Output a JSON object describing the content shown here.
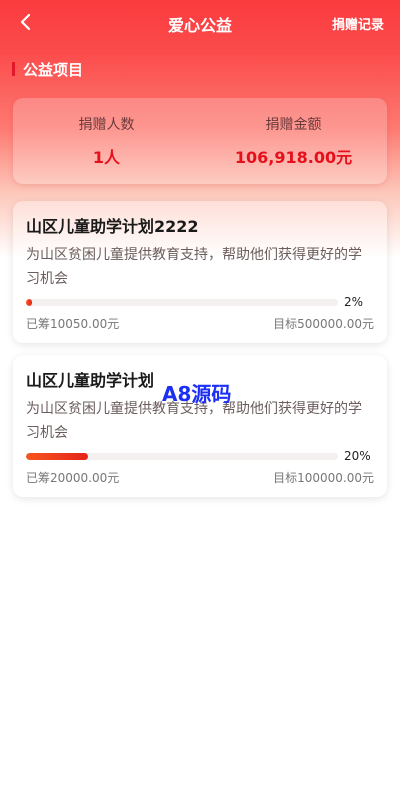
{
  "header": {
    "title": "爱心公益",
    "records_link": "捐赠记录"
  },
  "section": {
    "title": "公益项目"
  },
  "stats": {
    "donors_label": "捐赠人数",
    "donors_value": "1人",
    "amount_label": "捐赠金额",
    "amount_value": "106,918.00元"
  },
  "projects": [
    {
      "title": "山区儿童助学计划2222",
      "desc": "为山区贫困儿童提供教育支持，帮助他们获得更好的学习机会",
      "progress_pct": 2,
      "progress_text": "2%",
      "raised": "已筹10050.00元",
      "target": "目标500000.00元"
    },
    {
      "title": "山区儿童助学计划",
      "desc": "为山区贫困儿童提供教育支持，帮助他们获得更好的学习机会",
      "progress_pct": 20,
      "progress_text": "20%",
      "raised": "已筹20000.00元",
      "target": "目标100000.00元"
    }
  ],
  "watermark": "A8源码",
  "colors": {
    "accent": "#fb3b3f",
    "value_red": "#e5101c",
    "progress": "#f7561f"
  },
  "icons": {
    "back": "chevron-left-icon"
  }
}
